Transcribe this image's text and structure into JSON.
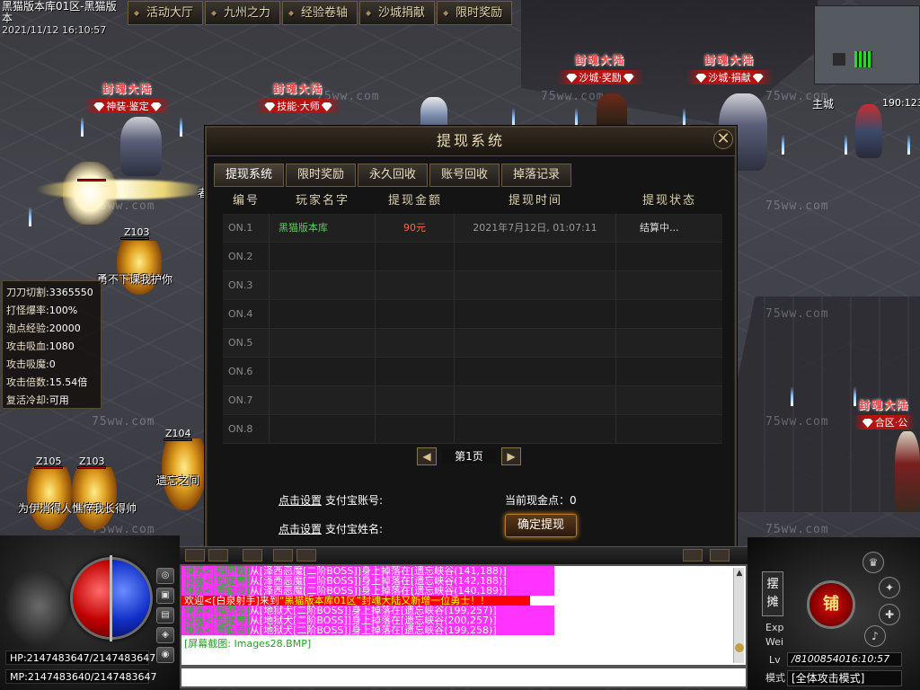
{
  "top": {
    "server_name": "黑猫版本库01区-黑猫版本",
    "datetime": "2021/11/12 16:10:57",
    "tabs": [
      "活动大厅",
      "九州之力",
      "经验卷轴",
      "沙城捐献",
      "限时奖励"
    ]
  },
  "minimap": {
    "area": "主城",
    "coords": "190:123"
  },
  "banners": [
    {
      "title": "封魂大陆",
      "sub": "神装·鉴定"
    },
    {
      "title": "封魂大陆",
      "sub": "技能·大师"
    },
    {
      "title": "封魂大陆",
      "sub": "沙城·奖励"
    },
    {
      "title": "封魂大陆",
      "sub": "沙城·捐献"
    },
    {
      "title": "封魂大陆",
      "sub": "合区·公"
    }
  ],
  "players": {
    "main_title": "勇不下课我护你",
    "tag1": "Z103",
    "tag2": "Z104",
    "tag3": "Z105",
    "tag4": "Z103",
    "npc_name": "遗忘之间",
    "left_guild": "为伊消得人憔悴我长得帅",
    "edge_char": "者"
  },
  "stats": [
    {
      "k": "刀刀切割",
      "v": "3365550"
    },
    {
      "k": "打怪爆率",
      "v": "100%"
    },
    {
      "k": "泡点经验",
      "v": "20000"
    },
    {
      "k": "攻击吸血",
      "v": "1080"
    },
    {
      "k": "攻击吸魔",
      "v": "0"
    },
    {
      "k": "攻击倍数",
      "v": "15.54倍"
    },
    {
      "k": "复活冷却",
      "v": "可用"
    }
  ],
  "dialog": {
    "title": "提现系统",
    "close": "✕",
    "tabs": [
      "提现系统",
      "限时奖励",
      "永久回收",
      "账号回收",
      "掉落记录"
    ],
    "columns": [
      "编号",
      "玩家名字",
      "提现金额",
      "提现时间",
      "提现状态"
    ],
    "rows": [
      {
        "no": "ON.1",
        "name": "黑猫版本库",
        "amount": "90元",
        "time": "2021年7月12日, 01:07:11",
        "status": "结算中..."
      },
      {
        "no": "ON.2",
        "name": "",
        "amount": "",
        "time": "",
        "status": ""
      },
      {
        "no": "ON.3",
        "name": "",
        "amount": "",
        "time": "",
        "status": ""
      },
      {
        "no": "ON.4",
        "name": "",
        "amount": "",
        "time": "",
        "status": ""
      },
      {
        "no": "ON.5",
        "name": "",
        "amount": "",
        "time": "",
        "status": ""
      },
      {
        "no": "ON.6",
        "name": "",
        "amount": "",
        "time": "",
        "status": ""
      },
      {
        "no": "ON.7",
        "name": "",
        "amount": "",
        "time": "",
        "status": ""
      },
      {
        "no": "ON.8",
        "name": "",
        "amount": "",
        "time": "",
        "status": ""
      }
    ],
    "page_label": "第1页",
    "prev": "◀",
    "next": "▶",
    "set_link": "点击设置",
    "alipay_account": "支付宝账号:",
    "alipay_name": "支付宝姓名:",
    "gold_label": "当前现金点：0",
    "confirm": "确定提现"
  },
  "hud": {
    "hp": "HP:2147483647/2147483647",
    "mp": "MP:2147483640/2147483647",
    "side_icons": [
      "◎",
      "▣",
      "▤",
      "◈",
      "◉"
    ],
    "stall": "摆摊",
    "shop": "铺",
    "exp_label": "Exp",
    "weight_label": "Wei",
    "lv_label": "Lv",
    "mode_label": "模式",
    "exp_value": "/8100854016:10:57",
    "attack_mode": "[全体攻击模式]"
  },
  "chat": {
    "lines": [
      {
        "type": "sys",
        "pre": "掉落<",
        "who": "[相思戰]",
        "mid": "从[泽西恶魔[二阶BOSS]]身上掉落在[遗忘峡谷(141,188)]"
      },
      {
        "type": "sys",
        "pre": "掉落<",
        "who": "[乾隆帝]",
        "mid": "从[泽西恶魔[二阶BOSS]]身上掉落在[遗忘峡谷(142,188)]"
      },
      {
        "type": "sys",
        "pre": "掉落<",
        "who": "[雪临帝]",
        "mid": "从[泽西恶魔[二阶BOSS]]身上掉落在[遗忘峡谷(140,189)]"
      },
      {
        "type": "announce",
        "text1": "欢迎<[白泉射手]来到",
        "text2": "“黑猫版本库01区”",
        "text3": "封魂大陆又新增一位勇士！！"
      },
      {
        "type": "sys",
        "pre": "掉落<",
        "who": "[相思帝]",
        "mid": "从[地狱犬[二阶BOSS]]身上掉落在[遗忘峡谷(199,257)]"
      },
      {
        "type": "sys",
        "pre": "掉落<",
        "who": "[乾隆帝]",
        "mid": "从[地狱犬[二阶BOSS]]身上掉落在[遗忘峡谷(200,257)]"
      },
      {
        "type": "sys",
        "pre": "掉落<",
        "who": "[雪临帝]",
        "mid": "从[地狱犬[二阶BOSS]]身上掉落在[遗忘峡谷(199,258)]"
      }
    ],
    "screenshot": "[屏幕截图: Images28.BMP]"
  },
  "watermark": "75ww.com"
}
